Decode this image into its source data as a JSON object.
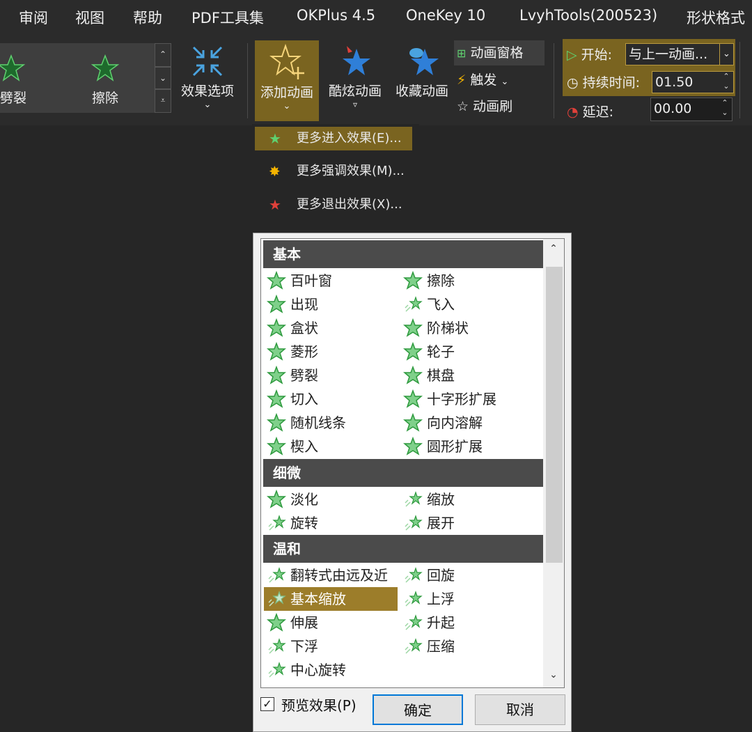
{
  "menubar": {
    "items": [
      "审阅",
      "视图",
      "帮助",
      "PDF工具集",
      "OKPlus 4.5",
      "OneKey 10",
      "LvyhTools(200523)",
      "形状格式"
    ]
  },
  "gallery": {
    "items": [
      "劈裂",
      "擦除"
    ]
  },
  "ribbon": {
    "effect_options": "效果选项",
    "add_animation": "添加动画",
    "cool_animation": "酷炫动画",
    "fav_animation": "收藏动画",
    "animation_pane": "动画窗格",
    "trigger": "触发",
    "animation_painter": "动画刷",
    "start_label": "开始:",
    "start_value": "与上一动画...",
    "duration_label": "持续时间:",
    "duration_value": "01.50",
    "delay_label": "延迟:",
    "delay_value": "00.00"
  },
  "dropdown": {
    "items": [
      "更多进入效果(E)...",
      "更多强调效果(M)...",
      "更多退出效果(X)..."
    ]
  },
  "dialog": {
    "sections": [
      "基本",
      "细微",
      "温和"
    ],
    "basic": [
      "百叶窗",
      "擦除",
      "出现",
      "飞入",
      "盒状",
      "阶梯状",
      "菱形",
      "轮子",
      "劈裂",
      "棋盘",
      "切入",
      "十字形扩展",
      "随机线条",
      "向内溶解",
      "楔入",
      "圆形扩展"
    ],
    "subtle": [
      "淡化",
      "缩放",
      "旋转",
      "展开"
    ],
    "moderate": [
      "翻转式由远及近",
      "回旋",
      "基本缩放",
      "上浮",
      "伸展",
      "升起",
      "下浮",
      "压缩",
      "中心旋转"
    ],
    "preview_label": "预览效果(P)",
    "ok_label": "确定",
    "cancel_label": "取消"
  },
  "colors": {
    "accent": "#7a6420",
    "selected": "#9c7d2a",
    "star_green": "#2e9a3e"
  }
}
